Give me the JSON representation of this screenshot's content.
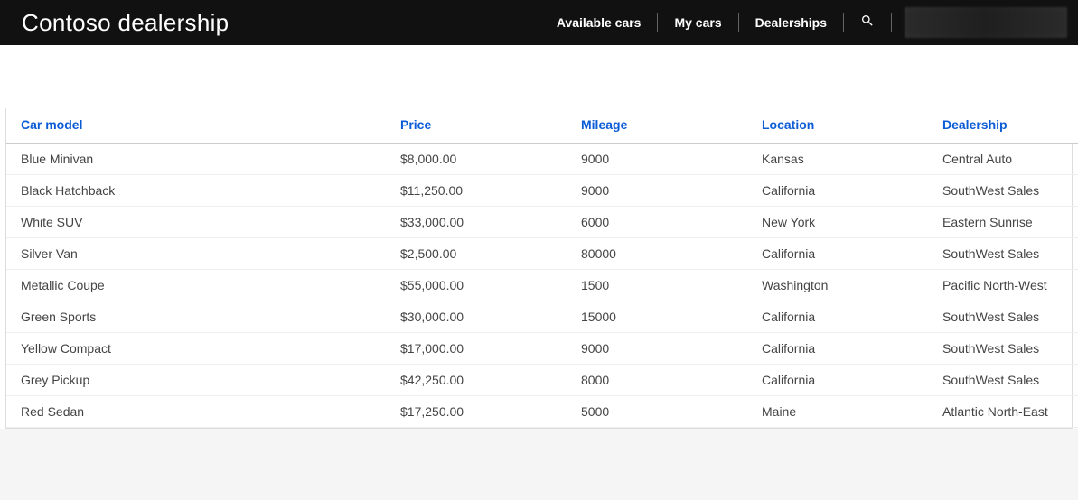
{
  "header": {
    "title": "Contoso dealership",
    "nav": [
      {
        "label": "Available cars"
      },
      {
        "label": "My cars"
      },
      {
        "label": "Dealerships"
      }
    ],
    "search_icon": "search"
  },
  "table": {
    "columns": [
      {
        "label": "Car model"
      },
      {
        "label": "Price"
      },
      {
        "label": "Mileage"
      },
      {
        "label": "Location"
      },
      {
        "label": "Dealership"
      }
    ],
    "rows": [
      {
        "model": "Blue Minivan",
        "price": "$8,000.00",
        "mileage": "9000",
        "location": "Kansas",
        "dealership": "Central Auto"
      },
      {
        "model": "Black Hatchback",
        "price": "$11,250.00",
        "mileage": "9000",
        "location": "California",
        "dealership": "SouthWest Sales"
      },
      {
        "model": "White SUV",
        "price": "$33,000.00",
        "mileage": "6000",
        "location": "New York",
        "dealership": "Eastern Sunrise"
      },
      {
        "model": "Silver Van",
        "price": "$2,500.00",
        "mileage": "80000",
        "location": "California",
        "dealership": "SouthWest Sales"
      },
      {
        "model": "Metallic Coupe",
        "price": "$55,000.00",
        "mileage": "1500",
        "location": "Washington",
        "dealership": "Pacific North-West"
      },
      {
        "model": "Green Sports",
        "price": "$30,000.00",
        "mileage": "15000",
        "location": "California",
        "dealership": "SouthWest Sales"
      },
      {
        "model": "Yellow Compact",
        "price": "$17,000.00",
        "mileage": "9000",
        "location": "California",
        "dealership": "SouthWest Sales"
      },
      {
        "model": "Grey Pickup",
        "price": "$42,250.00",
        "mileage": "8000",
        "location": "California",
        "dealership": "SouthWest Sales"
      },
      {
        "model": "Red Sedan",
        "price": "$17,250.00",
        "mileage": "5000",
        "location": "Maine",
        "dealership": "Atlantic North-East"
      }
    ]
  }
}
